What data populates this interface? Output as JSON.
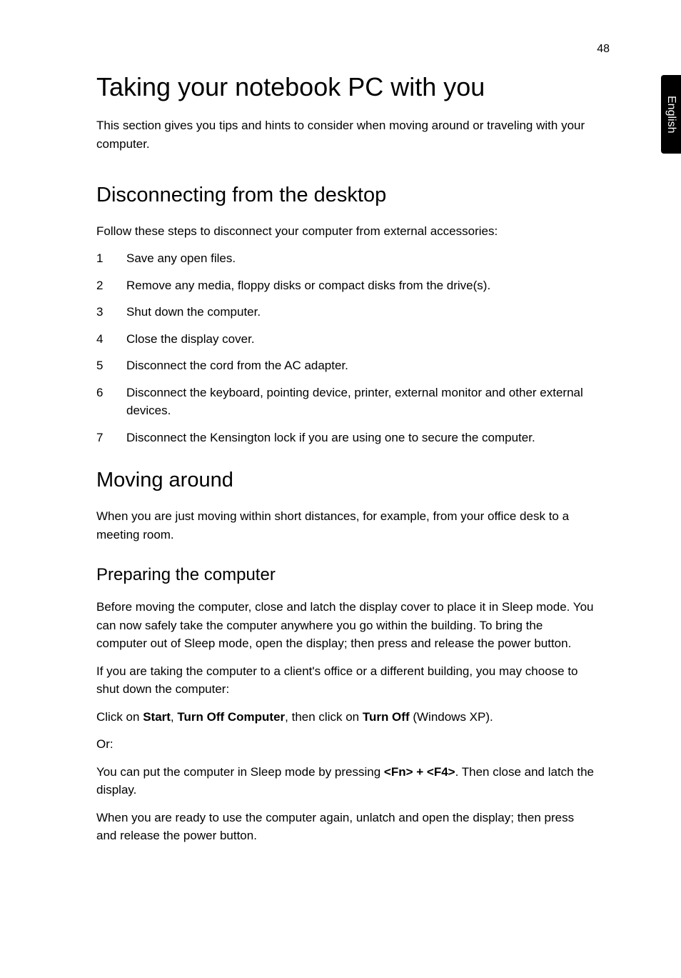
{
  "pageNumber": "48",
  "sideTab": "English",
  "h1": "Taking your notebook PC with you",
  "intro": "This section gives you tips and hints to consider when moving around or traveling with your computer.",
  "section1": {
    "heading": "Disconnecting from the desktop",
    "lead": "Follow these steps to disconnect your computer from external accessories:",
    "items": [
      "Save any open files.",
      "Remove any media, floppy disks or compact disks from the drive(s).",
      "Shut down the computer.",
      "Close the display cover.",
      "Disconnect the cord from the AC adapter.",
      "Disconnect the keyboard, pointing device, printer, external monitor and other external devices.",
      "Disconnect the Kensington lock if you are using one to secure the computer."
    ]
  },
  "section2": {
    "heading": "Moving around",
    "lead": "When you are just moving within short distances, for example, from your office desk to a meeting room.",
    "sub": {
      "heading": "Preparing the computer",
      "p1": "Before moving the computer, close and latch the display cover to place it in Sleep mode. You can now safely take the computer anywhere you go within the building. To bring the computer out of Sleep mode, open the display; then press and release the power button.",
      "p2": "If you are taking the computer to a client's office or a different building, you may choose to shut down the computer:",
      "p3_pre": "Click on ",
      "p3_b1": "Start",
      "p3_mid1": ", ",
      "p3_b2": "Turn Off Computer",
      "p3_mid2": ", then click on ",
      "p3_b3": "Turn Off",
      "p3_post": " (Windows XP).",
      "or": "Or:",
      "p4_pre": "You can put the computer in Sleep mode by pressing ",
      "p4_b": "<Fn> + <F4>",
      "p4_post": ". Then close and latch the display.",
      "p5": "When you are ready to use the computer again, unlatch and open the display; then press and release the power button."
    }
  }
}
